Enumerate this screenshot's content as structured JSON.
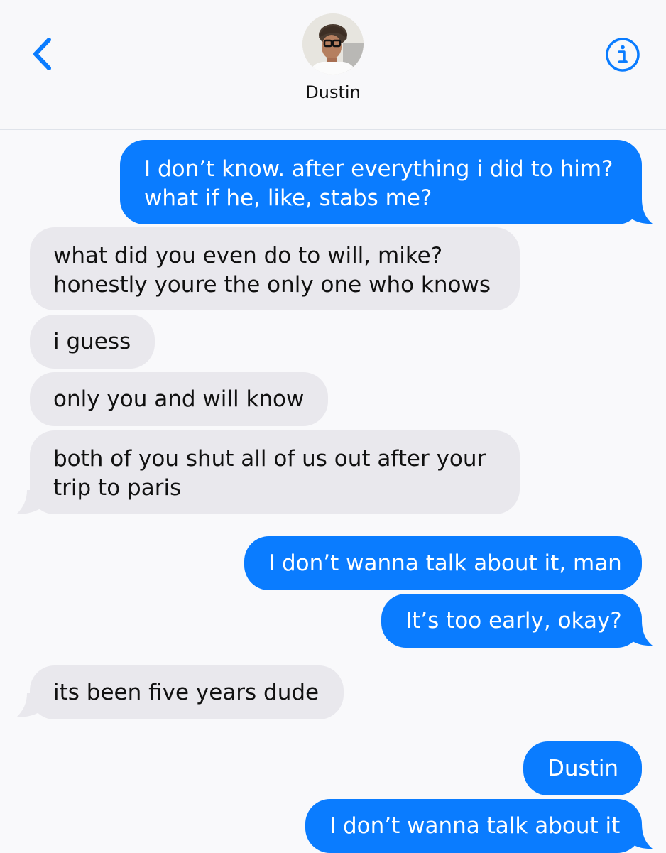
{
  "header": {
    "contact_name": "Dustin",
    "back_icon": "chevron-left-icon",
    "info_icon": "info-icon",
    "accent_color": "#0a7cff"
  },
  "messages": [
    {
      "sender": "me",
      "lines": [
        "I don’t know. after everything i did to him?",
        "what if he, like, stabs me?"
      ]
    },
    {
      "sender": "them",
      "lines": [
        "what did you even do to will, mike?",
        "honestly youre the only one who knows"
      ]
    },
    {
      "sender": "them",
      "lines": [
        "i guess"
      ]
    },
    {
      "sender": "them",
      "lines": [
        "only you and will know"
      ]
    },
    {
      "sender": "them",
      "lines": [
        "both of you shut all of us out after your",
        "trip to paris"
      ]
    },
    {
      "sender": "me",
      "lines": [
        "I don’t wanna talk about it, man"
      ]
    },
    {
      "sender": "me",
      "lines": [
        "It’s too early, okay?"
      ]
    },
    {
      "sender": "them",
      "lines": [
        "its been five years dude"
      ]
    },
    {
      "sender": "me",
      "lines": [
        "Dustin"
      ]
    },
    {
      "sender": "me",
      "lines": [
        "I don’t wanna talk about it"
      ]
    }
  ],
  "colors": {
    "outgoing_bubble": "#0a7cff",
    "incoming_bubble": "#e9e8ed",
    "background": "#f9f9fb"
  }
}
